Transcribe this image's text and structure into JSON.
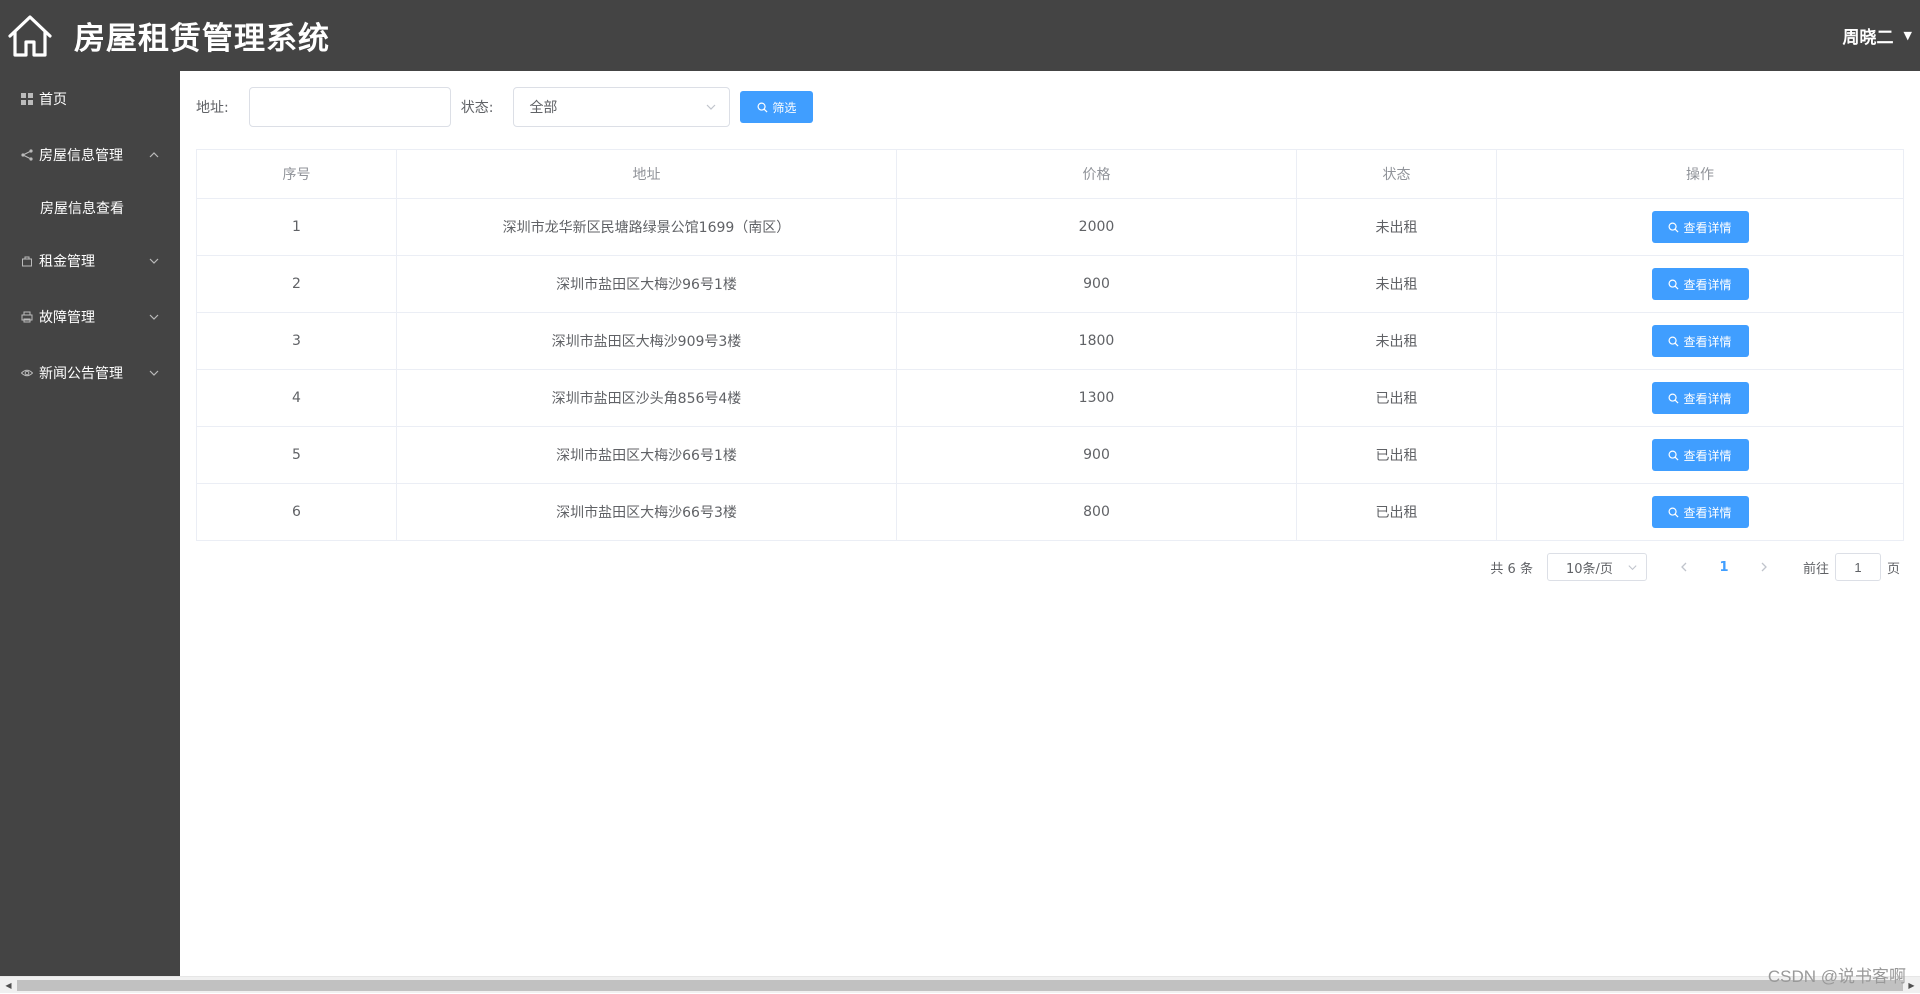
{
  "header": {
    "title": "房屋租赁管理系统",
    "user_name": "周晓二",
    "logo_icon": "house-outline-icon"
  },
  "sidebar": {
    "items": [
      {
        "label": "首页",
        "icon": "grid-icon"
      },
      {
        "label": "房屋信息管理",
        "icon": "share-icon",
        "expanded": true,
        "children": [
          {
            "label": "房屋信息查看"
          }
        ]
      },
      {
        "label": "租金管理",
        "icon": "bag-icon",
        "expanded": false
      },
      {
        "label": "故障管理",
        "icon": "printer-icon",
        "expanded": false
      },
      {
        "label": "新闻公告管理",
        "icon": "eye-icon",
        "expanded": false
      }
    ]
  },
  "filter": {
    "address_label": "地址:",
    "address_value": "",
    "status_label": "状态:",
    "status_value": "全部",
    "filter_button": "筛选"
  },
  "table": {
    "columns": [
      "序号",
      "地址",
      "价格",
      "状态",
      "操作"
    ],
    "detail_button": "查看详情",
    "rows": [
      {
        "index": "1",
        "address": "深圳市龙华新区民塘路绿景公馆1699（南区）",
        "price": "2000",
        "status": "未出租"
      },
      {
        "index": "2",
        "address": "深圳市盐田区大梅沙96号1楼",
        "price": "900",
        "status": "未出租"
      },
      {
        "index": "3",
        "address": "深圳市盐田区大梅沙909号3楼",
        "price": "1800",
        "status": "未出租"
      },
      {
        "index": "4",
        "address": "深圳市盐田区沙头角856号4楼",
        "price": "1300",
        "status": "已出租"
      },
      {
        "index": "5",
        "address": "深圳市盐田区大梅沙66号1楼",
        "price": "900",
        "status": "已出租"
      },
      {
        "index": "6",
        "address": "深圳市盐田区大梅沙66号3楼",
        "price": "800",
        "status": "已出租"
      }
    ]
  },
  "pagination": {
    "total": "共 6 条",
    "page_size": "10条/页",
    "current_page": "1",
    "goto_label": "前往",
    "goto_value": "1",
    "page_unit": "页"
  },
  "watermark": "CSDN @说书客啊",
  "colors": {
    "header_bg": "#444444",
    "primary": "#409eff",
    "border": "#ebeef5"
  }
}
